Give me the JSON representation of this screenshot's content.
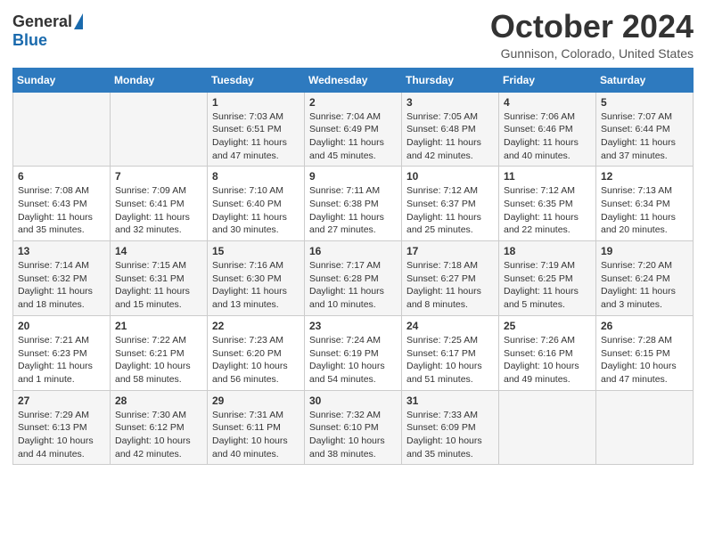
{
  "header": {
    "logo_general": "General",
    "logo_blue": "Blue",
    "title": "October 2024",
    "location": "Gunnison, Colorado, United States"
  },
  "days_of_week": [
    "Sunday",
    "Monday",
    "Tuesday",
    "Wednesday",
    "Thursday",
    "Friday",
    "Saturday"
  ],
  "weeks": [
    [
      {
        "day": "",
        "info": ""
      },
      {
        "day": "",
        "info": ""
      },
      {
        "day": "1",
        "info": "Sunrise: 7:03 AM\nSunset: 6:51 PM\nDaylight: 11 hours and 47 minutes."
      },
      {
        "day": "2",
        "info": "Sunrise: 7:04 AM\nSunset: 6:49 PM\nDaylight: 11 hours and 45 minutes."
      },
      {
        "day": "3",
        "info": "Sunrise: 7:05 AM\nSunset: 6:48 PM\nDaylight: 11 hours and 42 minutes."
      },
      {
        "day": "4",
        "info": "Sunrise: 7:06 AM\nSunset: 6:46 PM\nDaylight: 11 hours and 40 minutes."
      },
      {
        "day": "5",
        "info": "Sunrise: 7:07 AM\nSunset: 6:44 PM\nDaylight: 11 hours and 37 minutes."
      }
    ],
    [
      {
        "day": "6",
        "info": "Sunrise: 7:08 AM\nSunset: 6:43 PM\nDaylight: 11 hours and 35 minutes."
      },
      {
        "day": "7",
        "info": "Sunrise: 7:09 AM\nSunset: 6:41 PM\nDaylight: 11 hours and 32 minutes."
      },
      {
        "day": "8",
        "info": "Sunrise: 7:10 AM\nSunset: 6:40 PM\nDaylight: 11 hours and 30 minutes."
      },
      {
        "day": "9",
        "info": "Sunrise: 7:11 AM\nSunset: 6:38 PM\nDaylight: 11 hours and 27 minutes."
      },
      {
        "day": "10",
        "info": "Sunrise: 7:12 AM\nSunset: 6:37 PM\nDaylight: 11 hours and 25 minutes."
      },
      {
        "day": "11",
        "info": "Sunrise: 7:12 AM\nSunset: 6:35 PM\nDaylight: 11 hours and 22 minutes."
      },
      {
        "day": "12",
        "info": "Sunrise: 7:13 AM\nSunset: 6:34 PM\nDaylight: 11 hours and 20 minutes."
      }
    ],
    [
      {
        "day": "13",
        "info": "Sunrise: 7:14 AM\nSunset: 6:32 PM\nDaylight: 11 hours and 18 minutes."
      },
      {
        "day": "14",
        "info": "Sunrise: 7:15 AM\nSunset: 6:31 PM\nDaylight: 11 hours and 15 minutes."
      },
      {
        "day": "15",
        "info": "Sunrise: 7:16 AM\nSunset: 6:30 PM\nDaylight: 11 hours and 13 minutes."
      },
      {
        "day": "16",
        "info": "Sunrise: 7:17 AM\nSunset: 6:28 PM\nDaylight: 11 hours and 10 minutes."
      },
      {
        "day": "17",
        "info": "Sunrise: 7:18 AM\nSunset: 6:27 PM\nDaylight: 11 hours and 8 minutes."
      },
      {
        "day": "18",
        "info": "Sunrise: 7:19 AM\nSunset: 6:25 PM\nDaylight: 11 hours and 5 minutes."
      },
      {
        "day": "19",
        "info": "Sunrise: 7:20 AM\nSunset: 6:24 PM\nDaylight: 11 hours and 3 minutes."
      }
    ],
    [
      {
        "day": "20",
        "info": "Sunrise: 7:21 AM\nSunset: 6:23 PM\nDaylight: 11 hours and 1 minute."
      },
      {
        "day": "21",
        "info": "Sunrise: 7:22 AM\nSunset: 6:21 PM\nDaylight: 10 hours and 58 minutes."
      },
      {
        "day": "22",
        "info": "Sunrise: 7:23 AM\nSunset: 6:20 PM\nDaylight: 10 hours and 56 minutes."
      },
      {
        "day": "23",
        "info": "Sunrise: 7:24 AM\nSunset: 6:19 PM\nDaylight: 10 hours and 54 minutes."
      },
      {
        "day": "24",
        "info": "Sunrise: 7:25 AM\nSunset: 6:17 PM\nDaylight: 10 hours and 51 minutes."
      },
      {
        "day": "25",
        "info": "Sunrise: 7:26 AM\nSunset: 6:16 PM\nDaylight: 10 hours and 49 minutes."
      },
      {
        "day": "26",
        "info": "Sunrise: 7:28 AM\nSunset: 6:15 PM\nDaylight: 10 hours and 47 minutes."
      }
    ],
    [
      {
        "day": "27",
        "info": "Sunrise: 7:29 AM\nSunset: 6:13 PM\nDaylight: 10 hours and 44 minutes."
      },
      {
        "day": "28",
        "info": "Sunrise: 7:30 AM\nSunset: 6:12 PM\nDaylight: 10 hours and 42 minutes."
      },
      {
        "day": "29",
        "info": "Sunrise: 7:31 AM\nSunset: 6:11 PM\nDaylight: 10 hours and 40 minutes."
      },
      {
        "day": "30",
        "info": "Sunrise: 7:32 AM\nSunset: 6:10 PM\nDaylight: 10 hours and 38 minutes."
      },
      {
        "day": "31",
        "info": "Sunrise: 7:33 AM\nSunset: 6:09 PM\nDaylight: 10 hours and 35 minutes."
      },
      {
        "day": "",
        "info": ""
      },
      {
        "day": "",
        "info": ""
      }
    ]
  ]
}
